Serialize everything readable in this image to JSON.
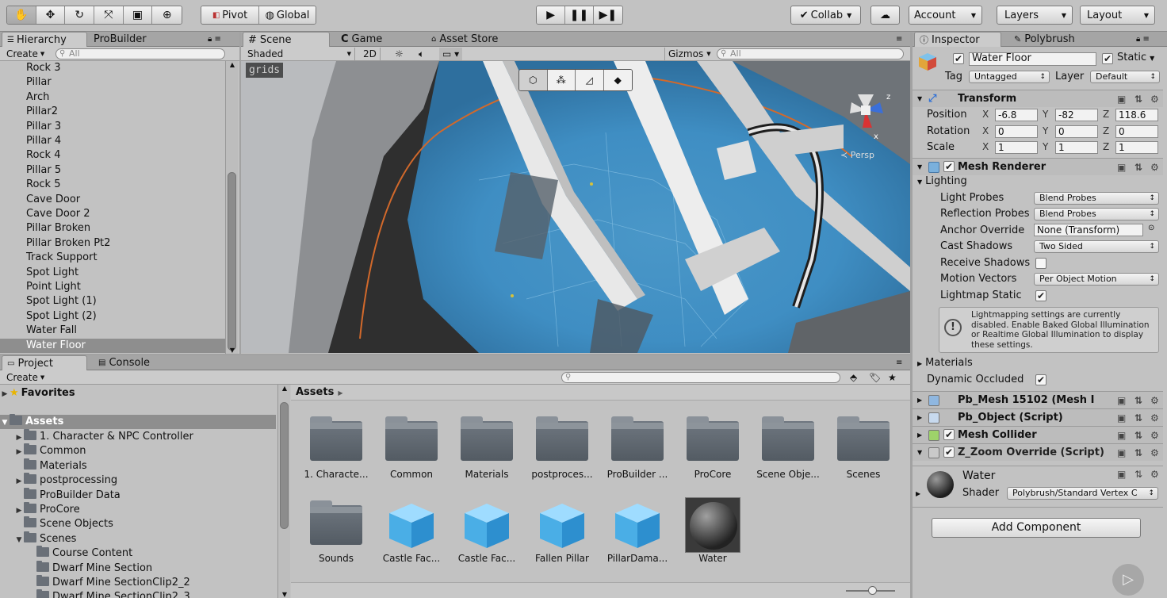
{
  "toolbar": {
    "transform_tools": [
      "hand-icon",
      "move-icon",
      "rotate-icon",
      "scale-icon",
      "rect-icon",
      "transform-icon"
    ],
    "pivot_label": "Pivot",
    "global_label": "Global",
    "collab_label": "Collab",
    "account_label": "Account",
    "layers_label": "Layers",
    "layout_label": "Layout"
  },
  "hierarchy": {
    "tab_label": "Hierarchy",
    "tab2_label": "ProBuilder",
    "create_label": "Create",
    "search_placeholder": "All",
    "items": [
      "Rock 3",
      "Pillar",
      "Arch",
      "Pillar2",
      "Pillar 3",
      "Pillar 4",
      "Rock 4",
      "Pillar 5",
      "Rock 5",
      "Cave Door",
      "Cave Door 2",
      "Pillar Broken",
      "Pillar Broken Pt2",
      "Track Support",
      "Spot Light",
      "Point Light",
      "Spot Light (1)",
      "Spot Light (2)",
      "Water Fall",
      "Water Floor"
    ],
    "selected": "Water Floor"
  },
  "scene": {
    "tab_scene": "Scene",
    "tab_game": "Game",
    "tab_asset_store": "Asset Store",
    "shading_mode": "Shaded",
    "mode_2d": "2D",
    "gizmos_label": "Gizmos",
    "search_placeholder": "All",
    "overlay_label": "grids",
    "persp_label": "Persp",
    "axis_z": "z",
    "axis_x": "x"
  },
  "project": {
    "tab_project": "Project",
    "tab_console": "Console",
    "create_label": "Create",
    "favorites_label": "Favorites",
    "assets_label": "Assets",
    "tree": [
      {
        "label": "1. Character & NPC Controller",
        "depth": 1,
        "arrow": true
      },
      {
        "label": "Common",
        "depth": 1,
        "arrow": true
      },
      {
        "label": "Materials",
        "depth": 1,
        "arrow": false
      },
      {
        "label": "postprocessing",
        "depth": 1,
        "arrow": true
      },
      {
        "label": "ProBuilder Data",
        "depth": 1,
        "arrow": false
      },
      {
        "label": "ProCore",
        "depth": 1,
        "arrow": true
      },
      {
        "label": "Scene Objects",
        "depth": 1,
        "arrow": false
      },
      {
        "label": "Scenes",
        "depth": 1,
        "arrow": "open"
      },
      {
        "label": "Course Content",
        "depth": 2,
        "arrow": false
      },
      {
        "label": "Dwarf Mine Section",
        "depth": 2,
        "arrow": false
      },
      {
        "label": "Dwarf Mine SectionClip2_2",
        "depth": 2,
        "arrow": false
      },
      {
        "label": "Dwarf Mine SectionClip2_3",
        "depth": 2,
        "arrow": false
      }
    ],
    "breadcrumb": "Assets",
    "assets": [
      {
        "label": "1. Characte...",
        "kind": "folder"
      },
      {
        "label": "Common",
        "kind": "folder"
      },
      {
        "label": "Materials",
        "kind": "folder"
      },
      {
        "label": "postproces...",
        "kind": "folder"
      },
      {
        "label": "ProBuilder ...",
        "kind": "folder"
      },
      {
        "label": "ProCore",
        "kind": "folder"
      },
      {
        "label": "Scene Obje...",
        "kind": "folder"
      },
      {
        "label": "Scenes",
        "kind": "folder"
      },
      {
        "label": "Sounds",
        "kind": "folder"
      },
      {
        "label": "Castle Fac...",
        "kind": "prefab"
      },
      {
        "label": "Castle Fac...",
        "kind": "prefab"
      },
      {
        "label": "Fallen Pillar",
        "kind": "prefab"
      },
      {
        "label": "PillarDama...",
        "kind": "prefab"
      },
      {
        "label": "Water",
        "kind": "material"
      }
    ]
  },
  "inspector": {
    "tab_inspector": "Inspector",
    "tab_polybrush": "Polybrush",
    "object_name": "Water Floor",
    "static_label": "Static",
    "tag_label": "Tag",
    "tag_value": "Untagged",
    "layer_label": "Layer",
    "layer_value": "Default",
    "transform": {
      "title": "Transform",
      "position_label": "Position",
      "rotation_label": "Rotation",
      "scale_label": "Scale",
      "position": {
        "x": "-6.8",
        "y": "-82",
        "z": "118.6"
      },
      "rotation": {
        "x": "0",
        "y": "0",
        "z": "0"
      },
      "scale": {
        "x": "1",
        "y": "1",
        "z": "1"
      }
    },
    "axis_labels": {
      "x": "X",
      "y": "Y",
      "z": "Z"
    },
    "mesh_renderer": {
      "title": "Mesh Renderer",
      "lighting_label": "Lighting",
      "light_probes_label": "Light Probes",
      "light_probes_value": "Blend Probes",
      "reflection_probes_label": "Reflection Probes",
      "reflection_probes_value": "Blend Probes",
      "anchor_override_label": "Anchor Override",
      "anchor_override_value": "None (Transform)",
      "cast_shadows_label": "Cast Shadows",
      "cast_shadows_value": "Two Sided",
      "receive_shadows_label": "Receive Shadows",
      "motion_vectors_label": "Motion Vectors",
      "motion_vectors_value": "Per Object Motion",
      "lightmap_static_label": "Lightmap Static",
      "help_text": "Lightmapping settings are currently disabled. Enable Baked Global Illumination or Realtime Global Illumination to display these settings.",
      "materials_label": "Materials",
      "dynamic_occluded_label": "Dynamic Occluded"
    },
    "components": [
      "Pb_Mesh 15102 (Mesh I",
      "Pb_Object (Script)",
      "Mesh Collider",
      "Z_Zoom Override (Script)"
    ],
    "material_name": "Water",
    "shader_label": "Shader",
    "shader_value": "Polybrush/Standard Vertex C",
    "add_component_label": "Add Component"
  }
}
